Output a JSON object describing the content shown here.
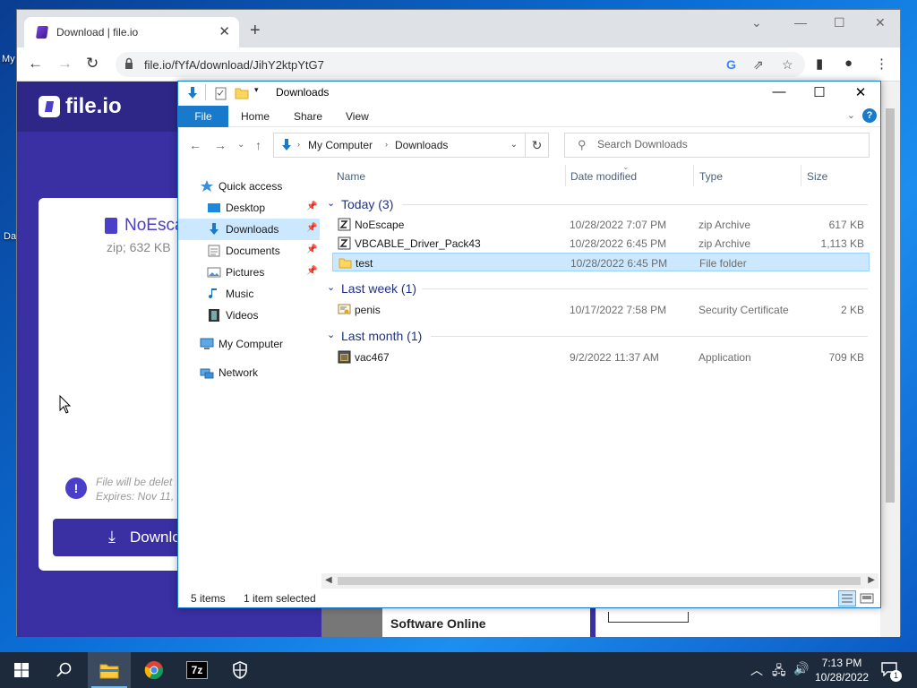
{
  "desktop": {
    "label_top": "My",
    "label_bottom": "Da"
  },
  "browser": {
    "tab_title": "Download | file.io",
    "url": "file.io/fYfA/download/JihY2ktpYtG7"
  },
  "webpage": {
    "logo": "file.io",
    "file_name": "NoEsca",
    "file_meta": "zip; 632 KB",
    "expiry_line1": "File will be delet",
    "expiry_line2": "Expires: Nov 11, :",
    "download_label": "Downlo",
    "ad_text": "Software Online"
  },
  "explorer": {
    "title": "Downloads",
    "ribbon_tabs": [
      "File",
      "Home",
      "Share",
      "View"
    ],
    "breadcrumb": [
      "My Computer",
      "Downloads"
    ],
    "search_placeholder": "Search Downloads",
    "nav": [
      {
        "label": "Quick access"
      },
      {
        "label": "Desktop"
      },
      {
        "label": "Downloads"
      },
      {
        "label": "Documents"
      },
      {
        "label": "Pictures"
      },
      {
        "label": "Music"
      },
      {
        "label": "Videos"
      },
      {
        "label": "My Computer"
      },
      {
        "label": "Network"
      }
    ],
    "columns": [
      "Name",
      "Date modified",
      "Type",
      "Size"
    ],
    "groups": [
      {
        "label": "Today (3)"
      },
      {
        "label": "Last week (1)"
      },
      {
        "label": "Last month (1)"
      }
    ],
    "files": [
      {
        "name": "NoEscape",
        "date": "10/28/2022 7:07 PM",
        "type": "zip Archive",
        "size": "617 KB"
      },
      {
        "name": "VBCABLE_Driver_Pack43",
        "date": "10/28/2022 6:45 PM",
        "type": "zip Archive",
        "size": "1,113 KB"
      },
      {
        "name": "test",
        "date": "10/28/2022 6:45 PM",
        "type": "File folder",
        "size": ""
      },
      {
        "name": "penis",
        "date": "10/17/2022 7:58 PM",
        "type": "Security Certificate",
        "size": "2 KB"
      },
      {
        "name": "vac467",
        "date": "9/2/2022 11:37 AM",
        "type": "Application",
        "size": "709 KB"
      }
    ],
    "status_items": "5 items",
    "status_selected": "1 item selected"
  },
  "taskbar": {
    "time": "7:13 PM",
    "date": "10/28/2022",
    "notif_count": "1",
    "app_7z": "7z"
  },
  "colors": {
    "explorer_accent": "#1979ca",
    "selection": "#cce8ff",
    "fileio_purple": "#3a2fa3",
    "taskbar": "#1c2a3c"
  }
}
